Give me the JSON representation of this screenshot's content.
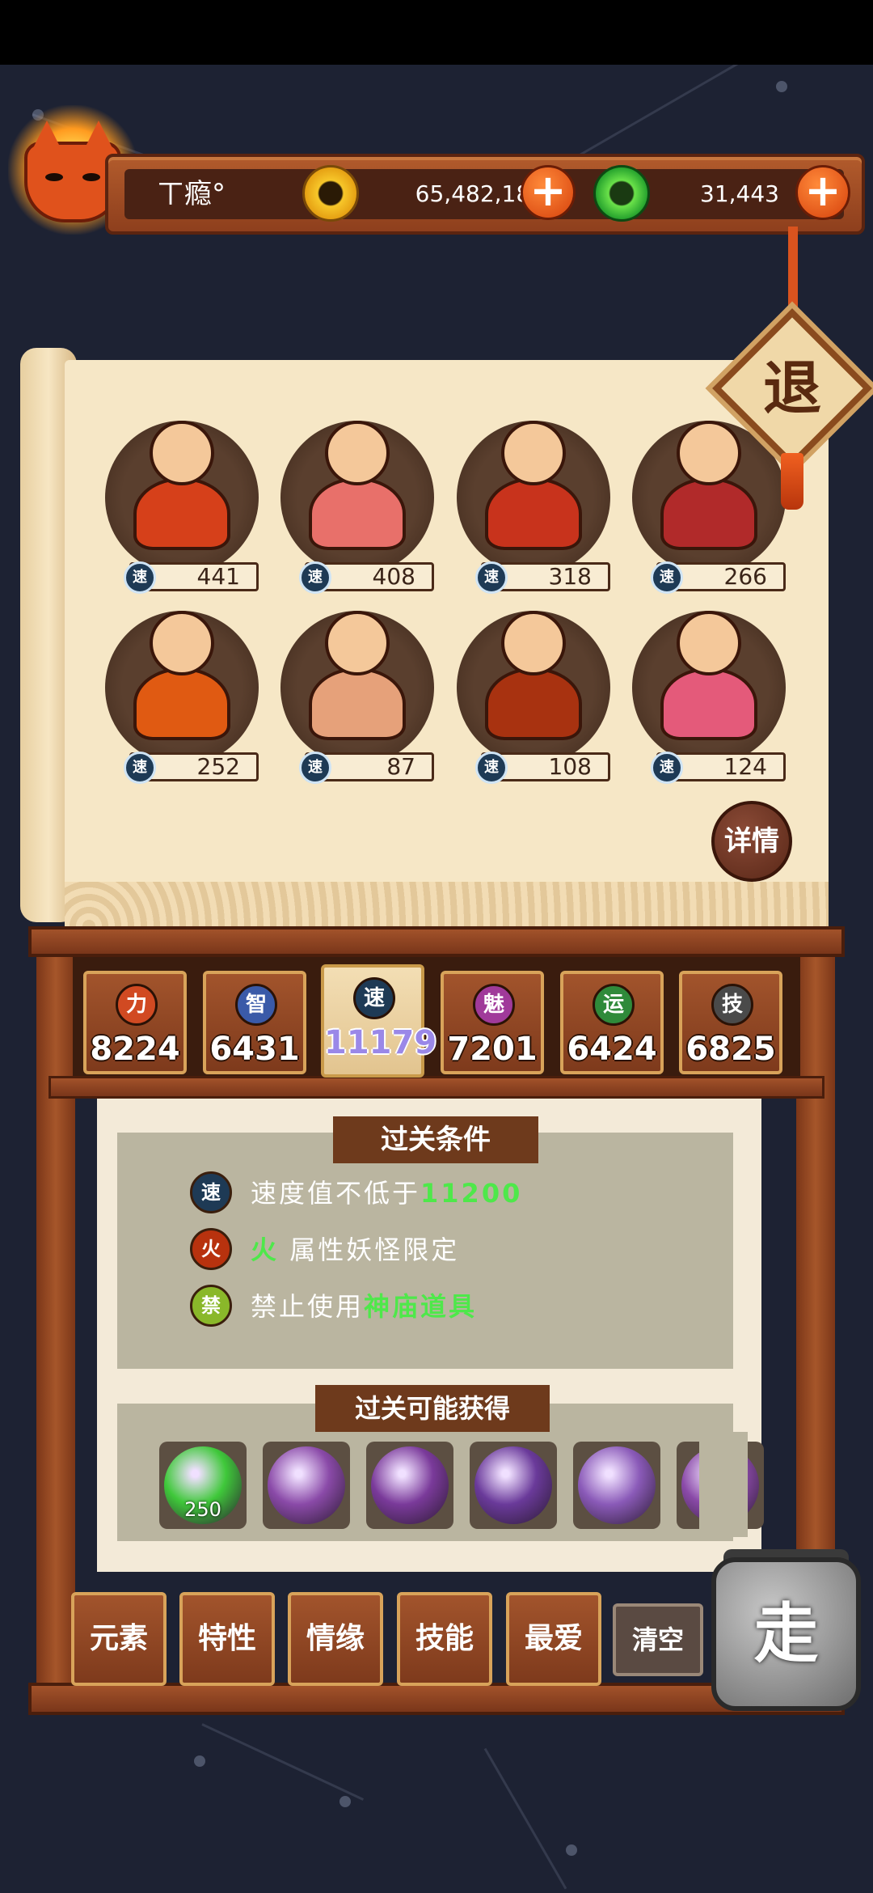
{
  "player": {
    "name": "ㄒ瘾°"
  },
  "currency": {
    "gold": "65,482,184",
    "jade": "31,443",
    "plus_label": "+"
  },
  "retreat_label": "退",
  "details_label": "详情",
  "speed_badge": "速",
  "monsters": [
    {
      "speed": "441",
      "color": "#d6401a"
    },
    {
      "speed": "408",
      "color": "#e8706a"
    },
    {
      "speed": "318",
      "color": "#c8331c"
    },
    {
      "speed": "266",
      "color": "#b12a2a"
    },
    {
      "speed": "252",
      "color": "#e05a12"
    },
    {
      "speed": "87",
      "color": "#e6a17a"
    },
    {
      "speed": "108",
      "color": "#a83210"
    },
    {
      "speed": "124",
      "color": "#e45a7a"
    }
  ],
  "stats": [
    {
      "badge": "力",
      "value": "8224",
      "color": "#d14a22"
    },
    {
      "badge": "智",
      "value": "6431",
      "color": "#3a5aa8"
    },
    {
      "badge": "速",
      "value": "11179",
      "color": "#1e3a55",
      "active": true
    },
    {
      "badge": "魅",
      "value": "7201",
      "color": "#a03a9a"
    },
    {
      "badge": "运",
      "value": "6424",
      "color": "#2f8a3a"
    },
    {
      "badge": "技",
      "value": "6825",
      "color": "#4a4a4a"
    }
  ],
  "conditions": {
    "title": "过关条件",
    "items": [
      {
        "icon": "速",
        "pre": "速度值不低于",
        "hl": "11200",
        "post": ""
      },
      {
        "icon": "火",
        "pre": "",
        "hl": "火",
        "post": " 属性妖怪限定"
      },
      {
        "icon": "禁",
        "pre": "禁止使用",
        "hl": "神庙道具",
        "post": ""
      }
    ]
  },
  "rewards": {
    "title": "过关可能获得",
    "items": [
      {
        "count": "250",
        "color": "#3fc83a"
      },
      {
        "count": "",
        "color": "#8a4aa8"
      },
      {
        "count": "",
        "color": "#7a3a9a"
      },
      {
        "count": "",
        "color": "#6a3a9a"
      },
      {
        "count": "",
        "color": "#8a5ab8"
      },
      {
        "count": "",
        "color": "#8a4aa8"
      }
    ]
  },
  "filters": [
    "元素",
    "特性",
    "情缘",
    "技能",
    "最爱"
  ],
  "clear_label": "清空",
  "go_label": "走"
}
